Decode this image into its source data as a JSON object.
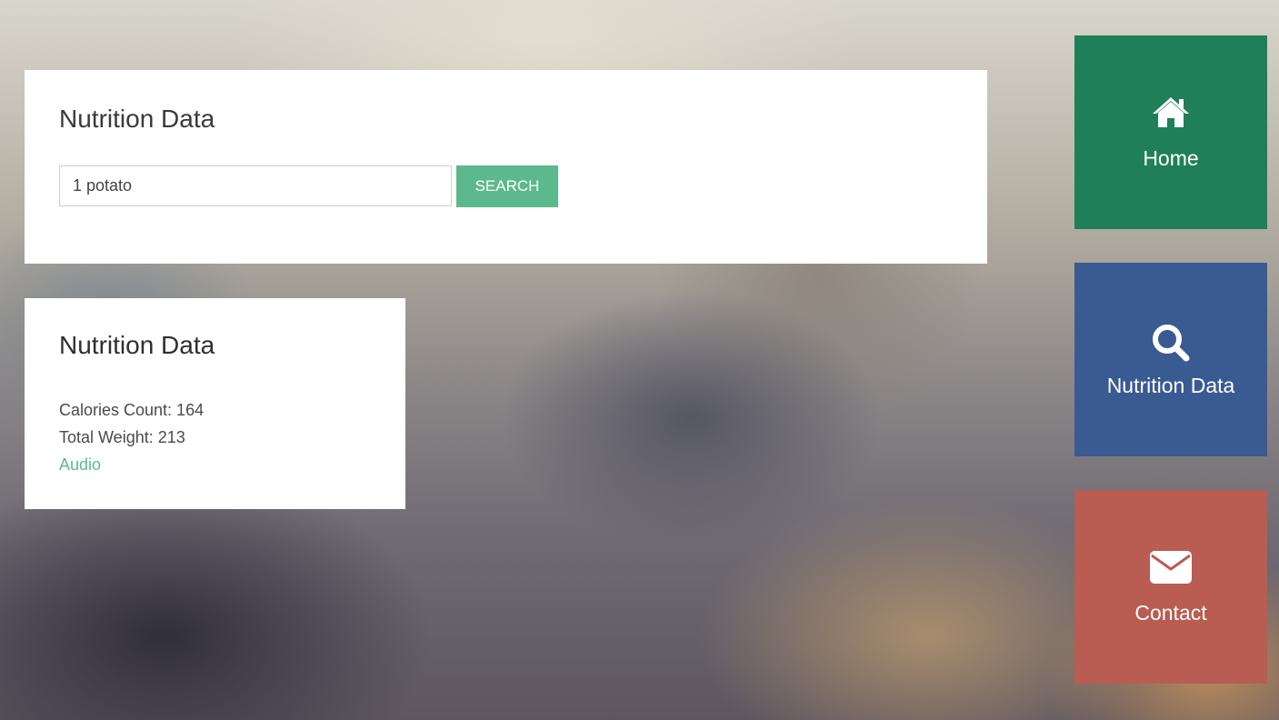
{
  "search_panel": {
    "title": "Nutrition Data",
    "input_value": "1 potato",
    "button_label": "SEARCH"
  },
  "result_panel": {
    "title": "Nutrition Data",
    "calories_line": "Calories Count: 164",
    "weight_line": "Total Weight: 213",
    "audio_link": "Audio"
  },
  "nav_tiles": [
    {
      "label": "Home",
      "icon": "home-icon",
      "color": "#1f7f58"
    },
    {
      "label": "Nutrition Data",
      "icon": "search-icon",
      "color": "#3a5a92"
    },
    {
      "label": "Contact",
      "icon": "envelope-icon",
      "color": "#b95c52"
    }
  ],
  "colors": {
    "accent_green": "#5cb98d"
  }
}
